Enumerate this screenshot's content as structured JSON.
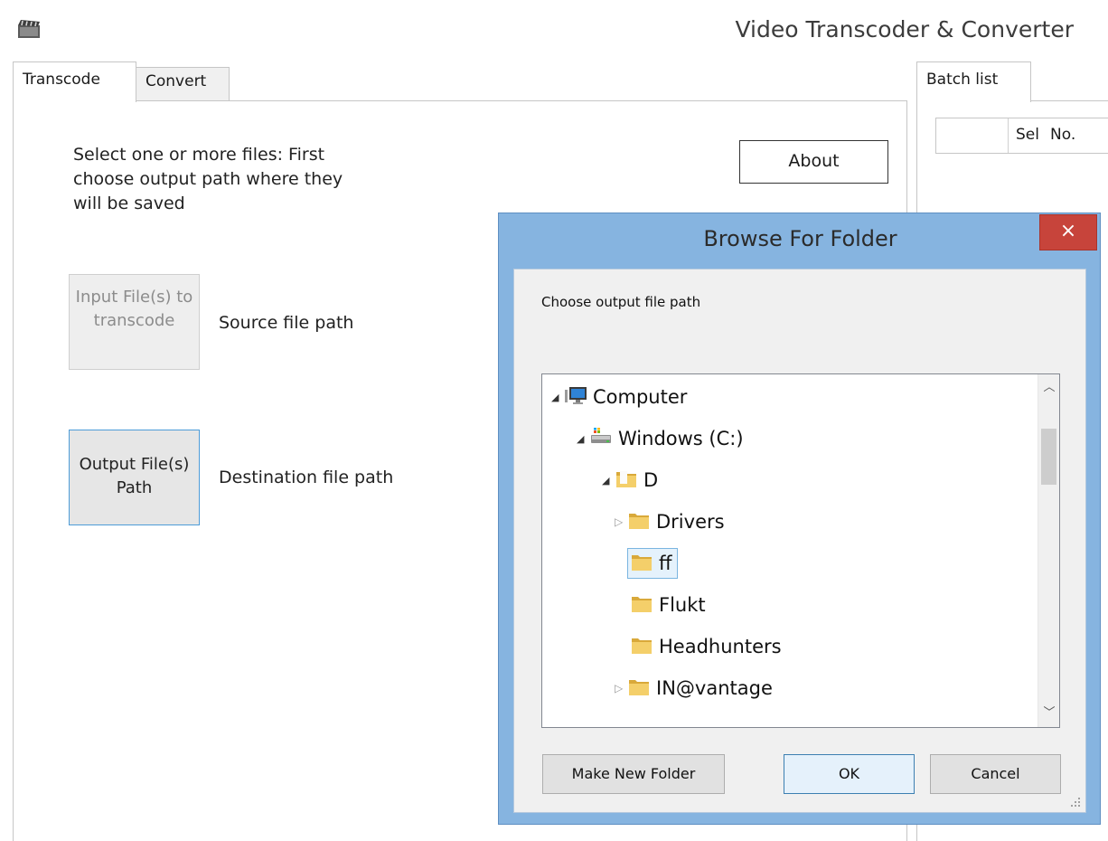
{
  "window": {
    "title": "Video Transcoder & Converter",
    "icon": "clapperboard-icon"
  },
  "tabs_left": [
    {
      "label": "Transcode",
      "active": true
    },
    {
      "label": "Convert",
      "active": false
    }
  ],
  "transcode": {
    "instructions": "Select one or more files: First choose output path where they will be saved",
    "about_label": "About",
    "input_button": "Input File(s) to transcode",
    "source_label": "Source file path",
    "output_button": "Output File(s) Path",
    "destination_label": "Destination file path"
  },
  "tabs_right": [
    {
      "label": "Batch list",
      "active": true
    }
  ],
  "batch_grid": {
    "columns": [
      "",
      "Sel",
      "No."
    ]
  },
  "dialog": {
    "title": "Browse For Folder",
    "close_label": "×",
    "prompt": "Choose output file path",
    "tree": [
      {
        "label": "Computer",
        "icon": "computer-icon",
        "expanded": true,
        "level": 0
      },
      {
        "label": "Windows (C:)",
        "icon": "drive-icon",
        "expanded": true,
        "level": 1
      },
      {
        "label": "D",
        "icon": "folder-icon",
        "expanded": true,
        "level": 2
      },
      {
        "label": "Drivers",
        "icon": "folder-icon",
        "expanded": false,
        "level": 3
      },
      {
        "label": "ff",
        "icon": "folder-icon",
        "selected": true,
        "level": 3
      },
      {
        "label": "Flukt",
        "icon": "folder-icon",
        "level": 3
      },
      {
        "label": "Headhunters",
        "icon": "folder-icon",
        "level": 3
      },
      {
        "label": "IN@vantage",
        "icon": "folder-icon",
        "expanded": false,
        "level": 3
      }
    ],
    "buttons": {
      "new_folder": "Make New Folder",
      "ok": "OK",
      "cancel": "Cancel"
    },
    "colors": {
      "frame": "#86b4e0",
      "close": "#c7443b",
      "selection": "#e5f2fc"
    }
  }
}
